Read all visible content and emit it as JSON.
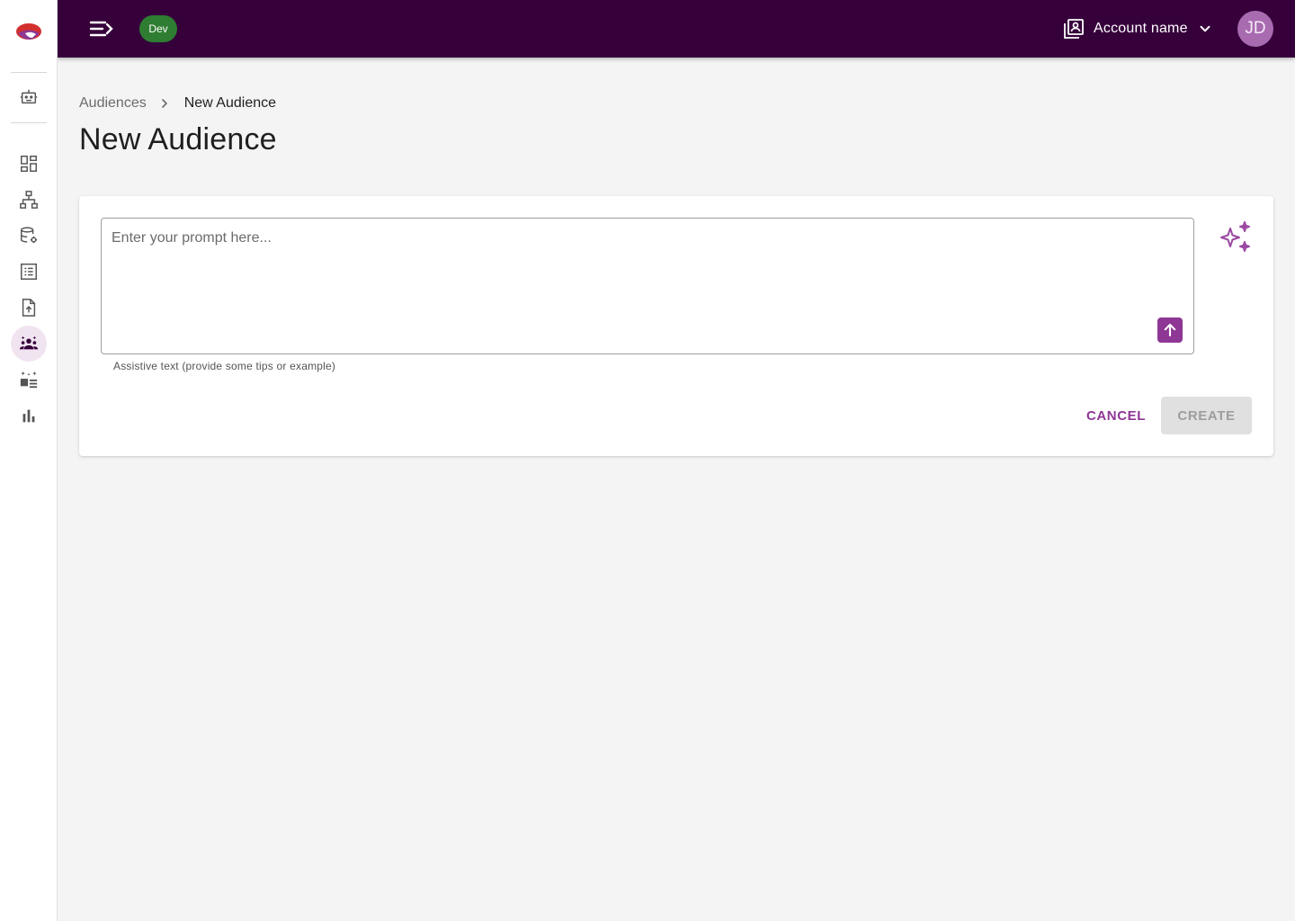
{
  "topbar": {
    "menu_icon": "menu-open-icon",
    "env_badge": "Dev",
    "account_icon": "account-box-icon",
    "account_name": "Account name",
    "account_chevron": "chevron-down-icon",
    "avatar_initials": "JD"
  },
  "sidebar": {
    "logo": "app-logo",
    "items": [
      {
        "icon": "robot-icon",
        "active": false
      },
      {
        "icon": "dashboard-icon",
        "active": false
      },
      {
        "icon": "hierarchy-icon",
        "active": false
      },
      {
        "icon": "database-settings-icon",
        "active": false
      },
      {
        "icon": "list-icon",
        "active": false
      },
      {
        "icon": "file-upload-icon",
        "active": false
      },
      {
        "icon": "audience-icon",
        "active": true
      },
      {
        "icon": "ai-content-icon",
        "active": false
      },
      {
        "icon": "bar-chart-icon",
        "active": false
      }
    ]
  },
  "breadcrumb": {
    "parent": "Audiences",
    "current": "New Audience"
  },
  "page": {
    "title": "New Audience"
  },
  "form": {
    "prompt_placeholder": "Enter your prompt here...",
    "prompt_value": "",
    "helper_text": "Assistive text (provide some tips or example)",
    "send_icon": "arrow-up-icon",
    "sparkle_icon": "sparkle-icon",
    "cancel_label": "CANCEL",
    "create_label": "CREATE"
  },
  "colors": {
    "topbar": "#36003b",
    "accent": "#8e3795",
    "env_badge": "#2e7d32",
    "active_nav_bg": "#f1e4f1",
    "avatar": "#a86bb0"
  }
}
